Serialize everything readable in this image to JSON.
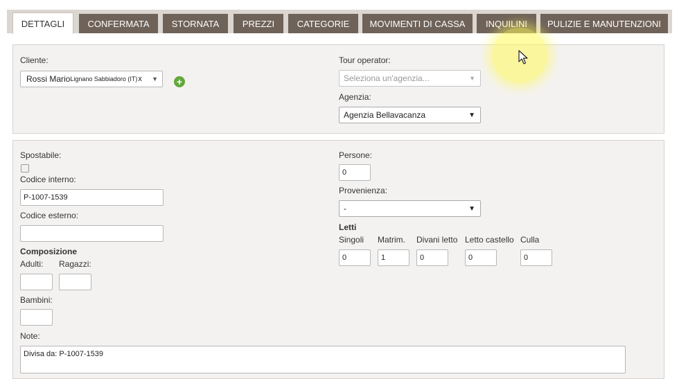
{
  "tabs": [
    {
      "label": "DETTAGLI",
      "active": true
    },
    {
      "label": "CONFERMATA"
    },
    {
      "label": "STORNATA"
    },
    {
      "label": "PREZZI"
    },
    {
      "label": "CATEGORIE"
    },
    {
      "label": "MOVIMENTI DI CASSA"
    },
    {
      "label": "INQUILINI"
    },
    {
      "label": "PULIZIE E MANUTENZIONI"
    }
  ],
  "client": {
    "label": "Cliente:",
    "name": "Rossi Mario",
    "location": "Lignano Sabbiadoro (IT)",
    "clear": "x"
  },
  "tour_operator": {
    "label": "Tour operator:",
    "placeholder": "Seleziona un'agenzia..."
  },
  "agency": {
    "label": "Agenzia:",
    "value": "Agenzia Bellavacanza"
  },
  "details": {
    "movable_label": "Spostabile:",
    "internal_code_label": "Codice interno:",
    "internal_code_value": "P-1007-1539",
    "external_code_label": "Codice esterno:",
    "external_code_value": "",
    "composition_heading": "Composizione",
    "adults_label": "Adulti:",
    "adults_value": "",
    "kids_label": "Ragazzi:",
    "kids_value": "",
    "children_label": "Bambini:",
    "children_value": "",
    "notes_label": "Note:",
    "notes_value": "Divisa da: P-1007-1539"
  },
  "people": {
    "label": "Persone:",
    "value": "0"
  },
  "origin": {
    "label": "Provenienza:",
    "value": "-"
  },
  "beds": {
    "heading": "Letti",
    "singles_label": "Singoli",
    "singles_value": "0",
    "double_label": "Matrim.",
    "double_value": "1",
    "sofa_label": "Divani letto",
    "sofa_value": "0",
    "bunk_label": "Letto castello",
    "bunk_value": "0",
    "crib_label": "Culla",
    "crib_value": "0"
  },
  "icons": {
    "add": "plus-circle-icon",
    "dropdown": "triangle-down",
    "cursor": "mouse-pointer-icon"
  },
  "colors": {
    "tab_bg": "#6f6259",
    "tab_active_bg": "#ffffff",
    "panel_bg": "#f4f2f1",
    "add_green": "#62a83a",
    "highlight": "#fff95a"
  }
}
